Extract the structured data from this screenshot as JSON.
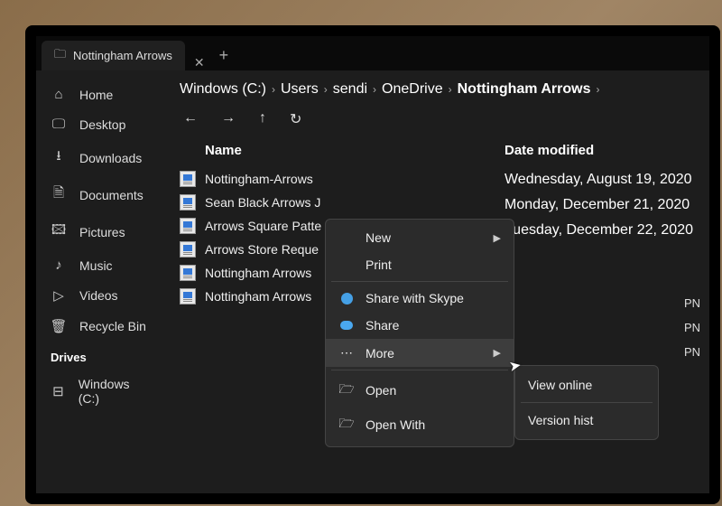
{
  "tab": {
    "title": "Nottingham Arrows"
  },
  "sidebar": {
    "items": [
      {
        "label": "Home",
        "icon": "home"
      },
      {
        "label": "Desktop",
        "icon": "monitor"
      },
      {
        "label": "Downloads",
        "icon": "download"
      },
      {
        "label": "Documents",
        "icon": "document"
      },
      {
        "label": "Pictures",
        "icon": "image"
      },
      {
        "label": "Music",
        "icon": "music"
      },
      {
        "label": "Videos",
        "icon": "video"
      },
      {
        "label": "Recycle Bin",
        "icon": "trash"
      }
    ],
    "drives_label": "Drives",
    "drive": "Windows (C:)"
  },
  "breadcrumb": [
    "Windows (C:)",
    "Users",
    "sendi",
    "OneDrive",
    "Nottingham Arrows"
  ],
  "columns": {
    "name": "Name",
    "date": "Date modified"
  },
  "files": [
    "Nottingham-Arrows",
    "Sean Black Arrows J",
    "Arrows Square Patte",
    "Arrows Store Reque",
    "Nottingham Arrows",
    "Nottingham Arrows"
  ],
  "dates": [
    "Wednesday, August 19, 2020",
    "Monday, December 21, 2020",
    "Tuesday, December 22, 2020"
  ],
  "context_menu": {
    "items": [
      {
        "label": "New",
        "icon": "",
        "arrow": true
      },
      {
        "label": "Print",
        "icon": ""
      },
      {
        "label": "Share with Skype",
        "icon": "skype"
      },
      {
        "label": "Share",
        "icon": "cloud"
      },
      {
        "label": "More",
        "icon": "dots",
        "highlighted": true,
        "arrow": true
      },
      {
        "label": "Open",
        "icon": "open"
      },
      {
        "label": "Open With",
        "icon": "open"
      }
    ]
  },
  "submenu": {
    "items": [
      {
        "label": "View online"
      },
      {
        "label": "Version hist"
      }
    ]
  },
  "pn_marks": [
    "PN",
    "PN",
    "PN"
  ]
}
